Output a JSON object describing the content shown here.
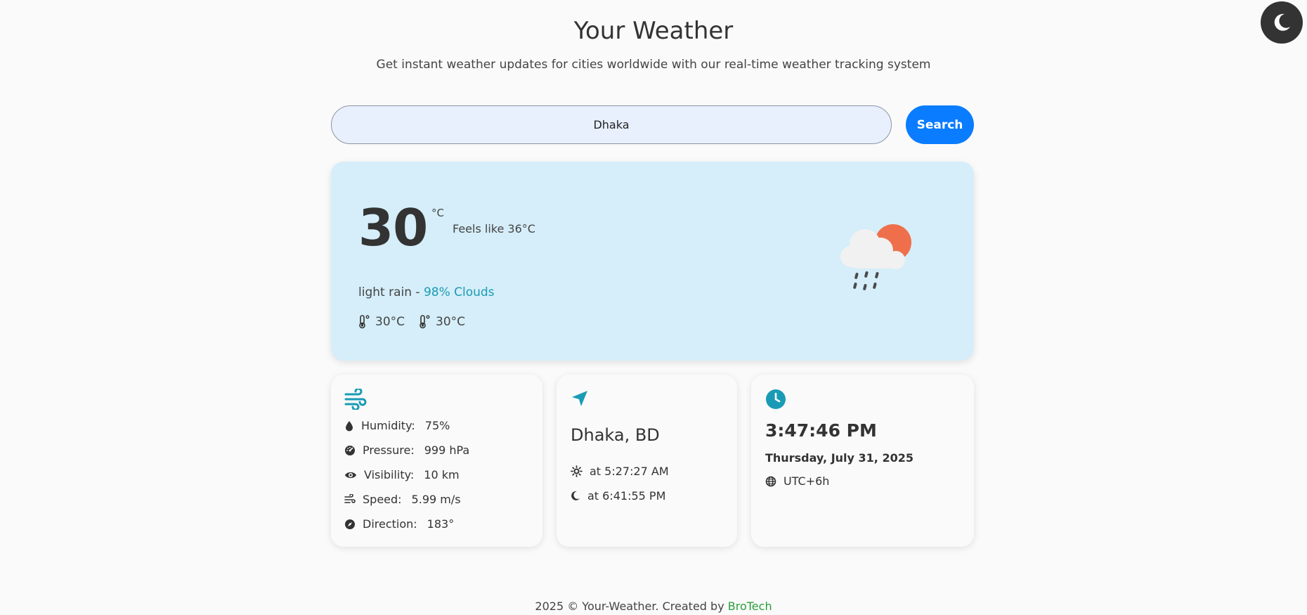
{
  "header": {
    "title": "Your Weather",
    "subtitle": "Get instant weather updates for cities worldwide with our real-time weather tracking system"
  },
  "search": {
    "value": "Dhaka",
    "button_label": "Search"
  },
  "theme_toggle": {
    "icon": "moon-icon"
  },
  "current": {
    "temperature": "30",
    "unit": "°C",
    "feels_like": "Feels like 36°C",
    "condition": "light rain - ",
    "clouds": "98% Clouds",
    "min_temp": "30°C",
    "max_temp": "30°C",
    "icon": "cloud-rain-sun-icon"
  },
  "details": {
    "humidity_label": "Humidity:",
    "humidity_value": "75%",
    "pressure_label": "Pressure:",
    "pressure_value": "999 hPa",
    "visibility_label": "Visibility:",
    "visibility_value": "10 km",
    "speed_label": "Speed:",
    "speed_value": "5.99 m/s",
    "direction_label": "Direction:",
    "direction_value": "183°"
  },
  "location": {
    "name": "Dhaka, BD",
    "sunrise": "at 5:27:27 AM",
    "sunset": "at 6:41:55 PM"
  },
  "time": {
    "clock": "3:47:46 PM",
    "date": "Thursday, July 31, 2025",
    "timezone": "UTC+6h"
  },
  "footer": {
    "text": "2025 © Your-Weather. Created by ",
    "brand": "BroTech"
  },
  "colors": {
    "accent": "#0a7cff",
    "teal": "#1a9bb5",
    "main_card_bg": "#d5eef9",
    "brand_green": "#2a9d3a"
  }
}
